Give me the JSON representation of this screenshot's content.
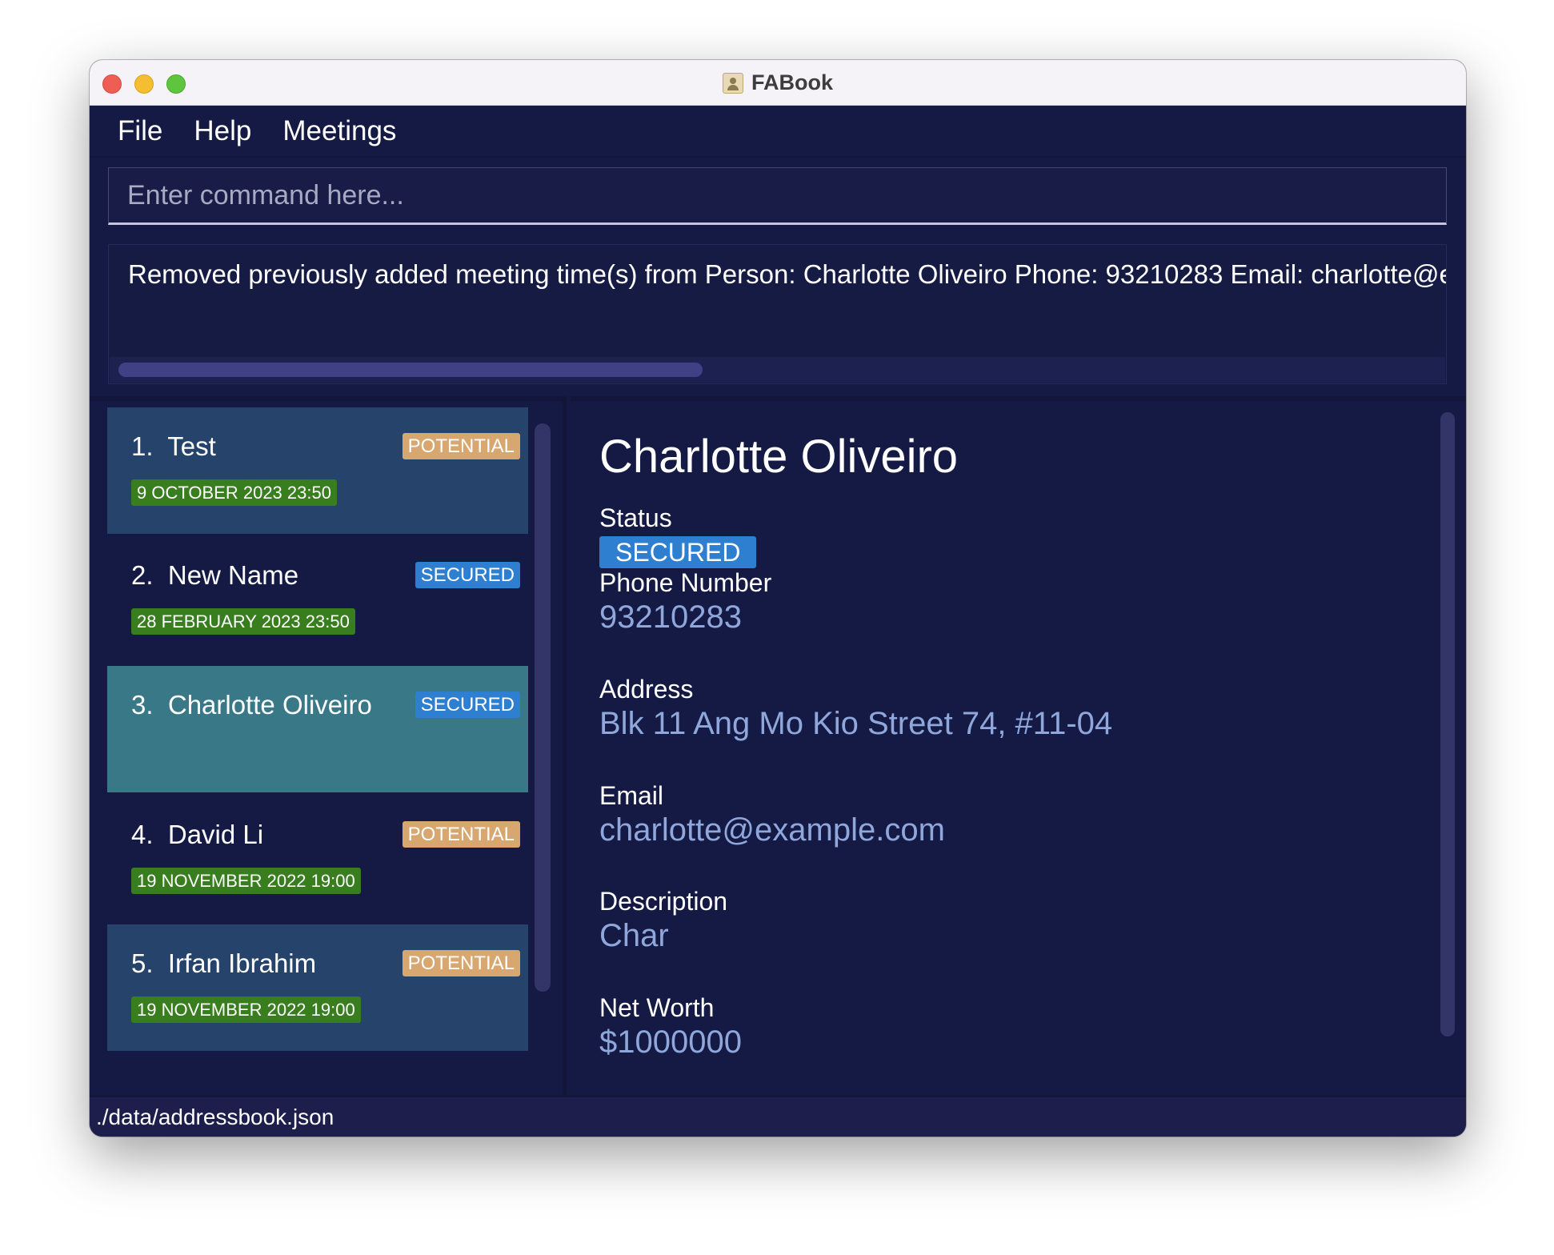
{
  "window": {
    "title": "FABook"
  },
  "menu": {
    "items": [
      "File",
      "Help",
      "Meetings"
    ]
  },
  "command": {
    "placeholder": "Enter command here...",
    "value": ""
  },
  "result": {
    "text": "Removed previously added meeting time(s) from Person: Charlotte Oliveiro Phone: 93210283 Email: charlotte@ex"
  },
  "list": {
    "cards": [
      {
        "index": "1.",
        "name": "Test",
        "status": "POTENTIAL",
        "meeting": "9 OCTOBER 2023 23:50"
      },
      {
        "index": "2.",
        "name": "New Name",
        "status": "SECURED",
        "meeting": "28 FEBRUARY 2023 23:50"
      },
      {
        "index": "3.",
        "name": "Charlotte Oliveiro",
        "status": "SECURED",
        "meeting": ""
      },
      {
        "index": "4.",
        "name": "David Li",
        "status": "POTENTIAL",
        "meeting": "19 NOVEMBER 2022 19:00"
      },
      {
        "index": "5.",
        "name": "Irfan Ibrahim",
        "status": "POTENTIAL",
        "meeting": "19 NOVEMBER 2022 19:00"
      }
    ],
    "selected_index": 2
  },
  "detail": {
    "name": "Charlotte Oliveiro",
    "status_label": "Status",
    "status": "SECURED",
    "phone_label": "Phone Number",
    "phone": "93210283",
    "address_label": "Address",
    "address": "Blk 11 Ang Mo Kio Street 74, #11-04",
    "email_label": "Email",
    "email": "charlotte@example.com",
    "description_label": "Description",
    "description": "Char",
    "networth_label": "Net Worth",
    "networth": "$1000000"
  },
  "statusbar": {
    "path": "./data/addressbook.json"
  },
  "colors": {
    "background": "#151a45",
    "card_alt": "#26446b",
    "card_selected": "#397887",
    "potential": "#d8a76f",
    "secured": "#2f7fd1",
    "meeting": "#387e1e",
    "detail_value": "#8fa7da"
  }
}
